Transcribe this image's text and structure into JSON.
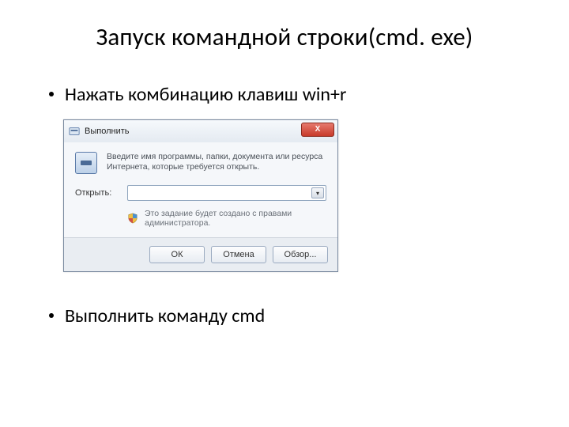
{
  "title": "Запуск командной строки(cmd. exe)",
  "bullets": {
    "first": "Нажать комбинацию клавиш win+r",
    "second": "Выполнить команду cmd"
  },
  "dialog": {
    "window_title": "Выполнить",
    "close_label": "X",
    "description": "Введите имя программы, папки, документа или ресурса Интернета, которые требуется открыть.",
    "open_label": "Открыть:",
    "admin_note": "Это задание будет создано с правами администратора.",
    "buttons": {
      "ok": "ОК",
      "cancel": "Отмена",
      "browse": "Обзор..."
    }
  }
}
